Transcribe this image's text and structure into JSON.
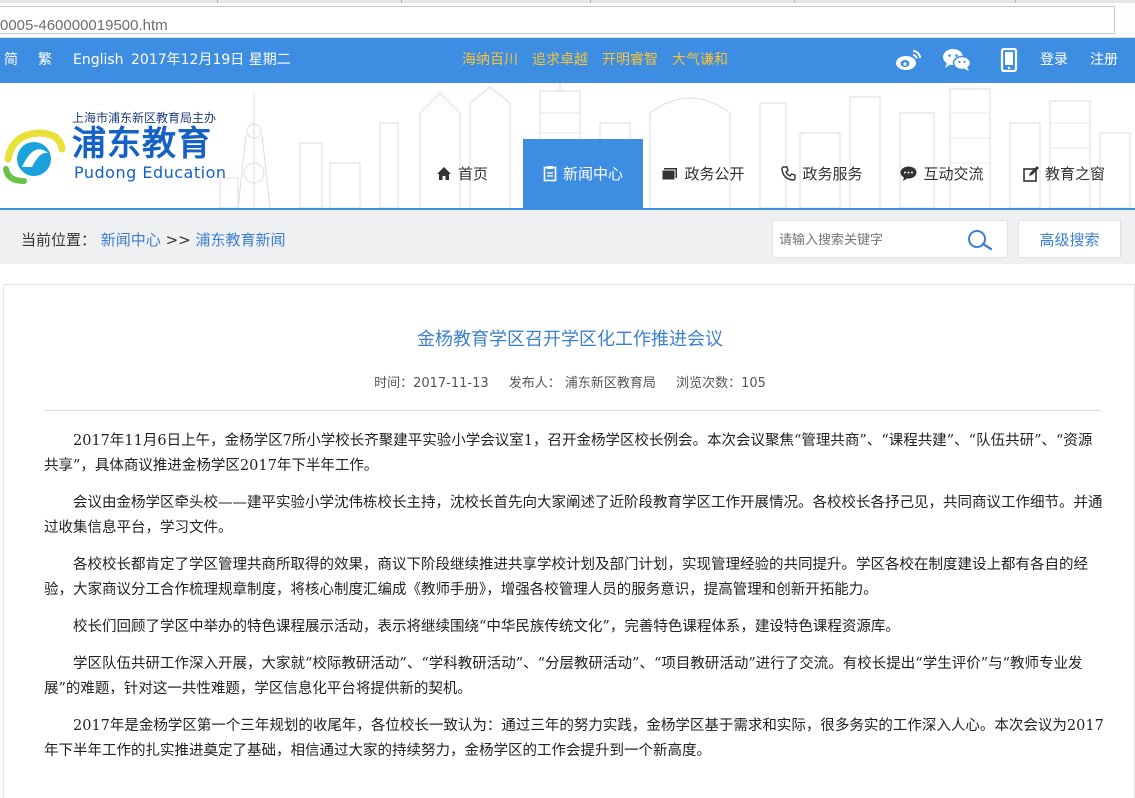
{
  "browser": {
    "address_text": "0005-460000019500.htm"
  },
  "topbar": {
    "simplified": "简",
    "traditional": "繁",
    "english": "English",
    "date": "2017年12月19日 星期二",
    "slogans": [
      "海纳百川",
      "追求卓越",
      "开明睿智",
      "大气谦和"
    ],
    "icons": [
      "weibo-icon",
      "wechat-icon",
      "mobile-icon"
    ],
    "login": "登录",
    "register": "注册",
    "colors": {
      "bar": "#3d8ee2",
      "slogan": "#f8c23a"
    }
  },
  "header": {
    "logo_subtitle": "上海市浦东新区教育局主办",
    "logo_title": "浦东教育",
    "logo_english": "Pudong  Education",
    "nav": [
      {
        "label": "首页",
        "icon": "home-icon"
      },
      {
        "label": "新闻中心",
        "icon": "document-icon",
        "active": true
      },
      {
        "label": "政务公开",
        "icon": "folder-icon"
      },
      {
        "label": "政务服务",
        "icon": "phone-icon"
      },
      {
        "label": "互动交流",
        "icon": "chat-icon"
      },
      {
        "label": "教育之窗",
        "icon": "edit-icon"
      }
    ]
  },
  "breadcrumb": {
    "prefix": "当前位置：",
    "level1": "新闻中心",
    "separator": " >> ",
    "level2": "浦东教育新闻"
  },
  "search": {
    "placeholder": "请输入搜索关键字",
    "advanced_label": "高级搜索"
  },
  "article": {
    "title": "金杨教育学区召开学区化工作推进会议",
    "time": "时间：2017-11-13",
    "publisher": "发布人：  浦东新区教育局",
    "views": "浏览次数：105",
    "paragraphs": [
      "2017年11月6日上午，金杨学区7所小学校长齐聚建平实验小学会议室1，召开金杨学区校长例会。本次会议聚焦“管理共商”、“课程共建”、“队伍共研”、“资源共享”，具体商议推进金杨学区2017年下半年工作。",
      "会议由金杨学区牵头校——建平实验小学沈伟栋校长主持，沈校长首先向大家阐述了近阶段教育学区工作开展情况。各校校长各抒己见，共同商议工作细节。并通过收集信息平台，学习文件。",
      "各校校长都肯定了学区管理共商所取得的效果，商议下阶段继续推进共享学校计划及部门计划，实现管理经验的共同提升。学区各校在制度建设上都有各自的经验，大家商议分工合作梳理规章制度，将核心制度汇编成《教师手册》，增强各校管理人员的服务意识，提高管理和创新开拓能力。",
      "校长们回顾了学区中举办的特色课程展示活动，表示将继续围绕“中华民族传统文化”，完善特色课程体系，建设特色课程资源库。",
      "学区队伍共研工作深入开展，大家就“校际教研活动”、“学科教研活动”、“分层教研活动”、“项目教研活动”进行了交流。有校长提出“学生评价”与“教师专业发展”的难题，针对这一共性难题，学区信息化平台将提供新的契机。",
      "2017年是金杨学区第一个三年规划的收尾年，各位校长一致认为：通过三年的努力实践，金杨学区基于需求和实际，很多务实的工作深入人心。本次会议为2017年下半年工作的扎实推进奠定了基础，相信通过大家的持续努力，金杨学区的工作会提升到一个新高度。"
    ]
  }
}
